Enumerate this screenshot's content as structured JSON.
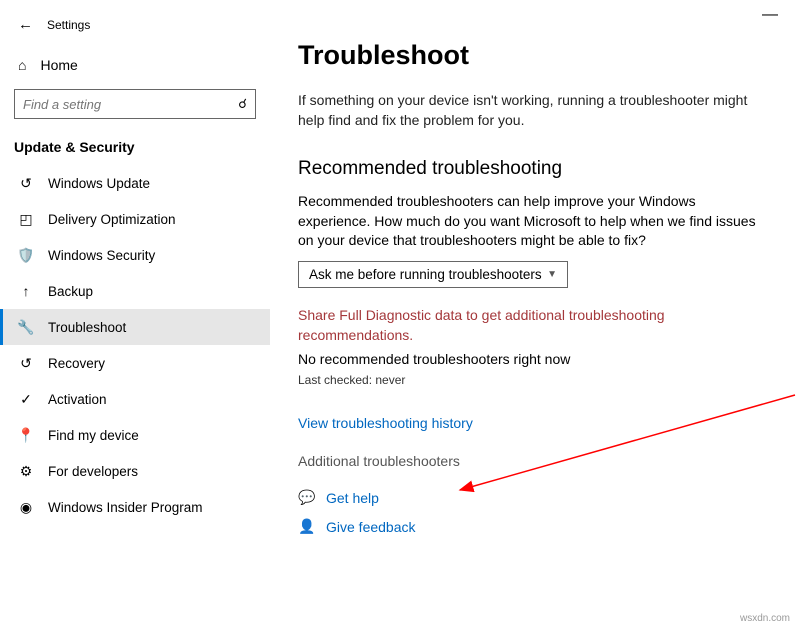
{
  "window": {
    "title": "Settings",
    "minimize": "—"
  },
  "sidebar": {
    "home": "Home",
    "searchPlaceholder": "Find a setting",
    "section": "Update & Security",
    "items": [
      {
        "label": "Windows Update"
      },
      {
        "label": "Delivery Optimization"
      },
      {
        "label": "Windows Security"
      },
      {
        "label": "Backup"
      },
      {
        "label": "Troubleshoot"
      },
      {
        "label": "Recovery"
      },
      {
        "label": "Activation"
      },
      {
        "label": "Find my device"
      },
      {
        "label": "For developers"
      },
      {
        "label": "Windows Insider Program"
      }
    ]
  },
  "main": {
    "title": "Troubleshoot",
    "intro": "If something on your device isn't working, running a troubleshooter might help find and fix the problem for you.",
    "recTitle": "Recommended troubleshooting",
    "recDesc": "Recommended troubleshooters can help improve your Windows experience. How much do you want Microsoft to help when we find issues on your device that troubleshooters might be able to fix?",
    "dropdown": "Ask me before running troubleshooters",
    "warn": "Share Full Diagnostic data to get additional troubleshooting recommendations.",
    "noRec": "No recommended troubleshooters right now",
    "lastChecked": "Last checked: never",
    "historyLink": "View troubleshooting history",
    "additional": "Additional troubleshooters",
    "getHelp": "Get help",
    "giveFeedback": "Give feedback"
  },
  "watermark": "wsxdn.com"
}
